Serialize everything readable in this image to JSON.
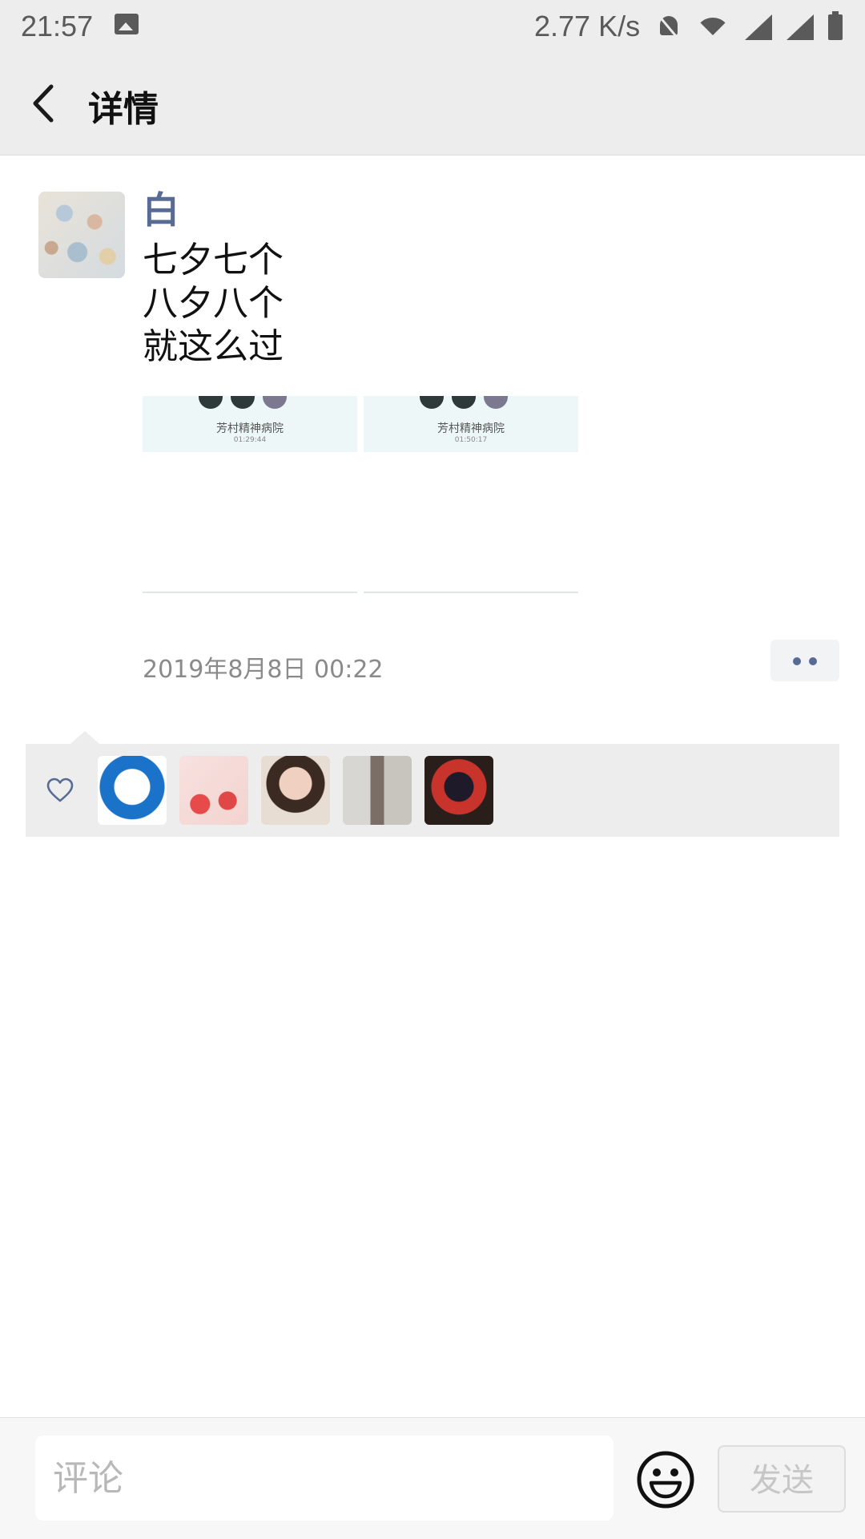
{
  "status_bar": {
    "time": "21:57",
    "network_speed": "2.77 K/s",
    "icons": [
      "image-icon",
      "bell-muted-icon",
      "wifi-icon",
      "signal-icon",
      "signal-icon",
      "battery-icon"
    ]
  },
  "header": {
    "title": "详情",
    "back_icon": "back-arrow-icon"
  },
  "post": {
    "author": "白",
    "text_lines": [
      "七夕七个",
      "八夕八个",
      "就这么过"
    ],
    "images": [
      {
        "caption": "芳村精神病院",
        "time": "01:29:44"
      },
      {
        "caption": "芳村精神病院",
        "time": "01:50:17"
      }
    ],
    "date": "2019年8月8日 00:22",
    "more_icon": "more-dots-icon"
  },
  "likes": {
    "icon": "heart-icon",
    "avatars": [
      "avatar-doraemon",
      "avatar-strawberry",
      "avatar-girl",
      "avatar-person-window",
      "avatar-anime"
    ]
  },
  "comment_bar": {
    "placeholder": "评论",
    "value": "",
    "emoji_icon": "emoji-icon",
    "send_label": "发送"
  },
  "colors": {
    "accent": "#576b95",
    "header_bg": "#ededed"
  }
}
